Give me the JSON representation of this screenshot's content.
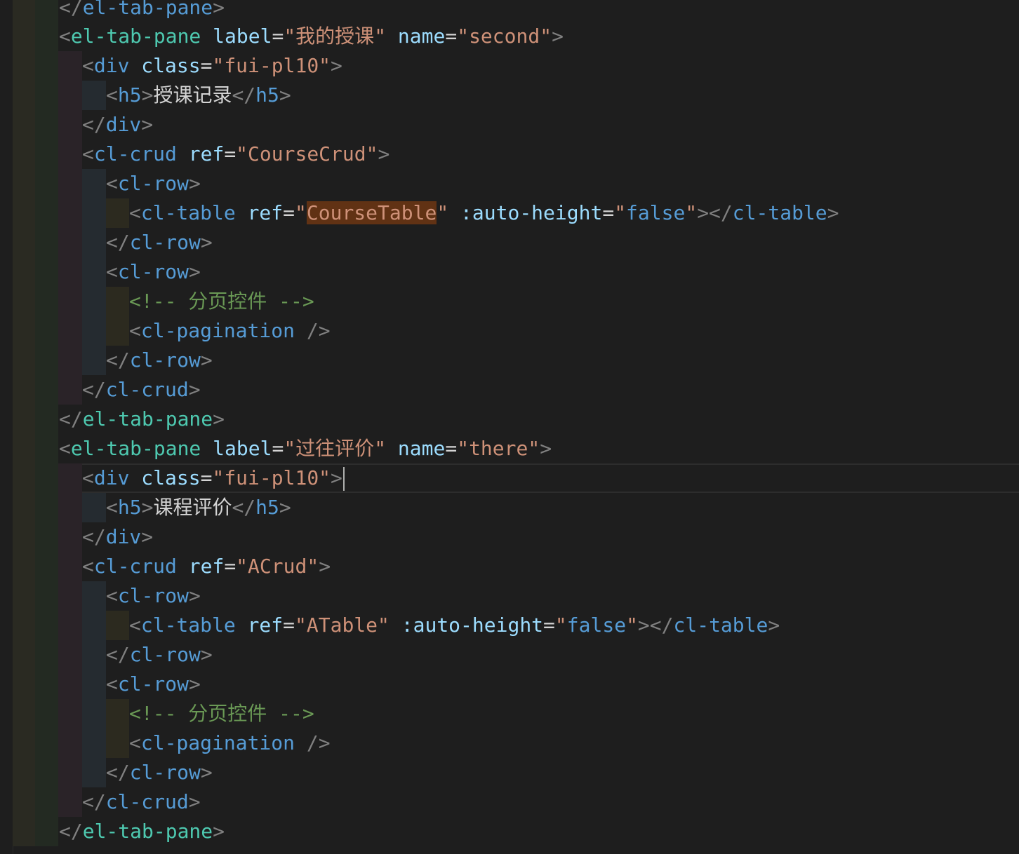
{
  "editor": {
    "theme_background": "#1e1e1e",
    "colors": {
      "bracket": "#808080",
      "tag": "#569cd6",
      "component_tag": "#4ec9b0",
      "attribute": "#9cdcfe",
      "string": "#ce9178",
      "comment": "#6a9955",
      "text": "#d4d4d4",
      "find_highlight": "#613214"
    },
    "lines": {
      "l0": {
        "close_tag": "el-tab-pane"
      },
      "l1": {
        "tag": "el-tab-pane",
        "attr1": "label",
        "val1": "我的授课",
        "attr2": "name",
        "val2": "second"
      },
      "l2": {
        "tag": "div",
        "attr1": "class",
        "val1": "fui-pl10"
      },
      "l3": {
        "tag": "h5",
        "text": "授课记录"
      },
      "l4": {
        "close_tag": "div"
      },
      "l5": {
        "tag": "cl-crud",
        "attr1": "ref",
        "val1": "CourseCrud"
      },
      "l6": {
        "tag": "cl-row"
      },
      "l7": {
        "tag": "cl-table",
        "attr1": "ref",
        "val1": "CourseTable",
        "attr2": ":auto-height",
        "val2": "false"
      },
      "l8": {
        "close_tag": "cl-row"
      },
      "l9": {
        "tag": "cl-row"
      },
      "l10": {
        "comment": "<!-- 分页控件 -->"
      },
      "l11": {
        "tag": "cl-pagination"
      },
      "l12": {
        "close_tag": "cl-row"
      },
      "l13": {
        "close_tag": "cl-crud"
      },
      "l14": {
        "close_tag": "el-tab-pane"
      },
      "l15": {
        "tag": "el-tab-pane",
        "attr1": "label",
        "val1": "过往评价",
        "attr2": "name",
        "val2": "there"
      },
      "l16": {
        "tag": "div",
        "attr1": "class",
        "val1": "fui-pl10"
      },
      "l17": {
        "tag": "h5",
        "text": "课程评价"
      },
      "l18": {
        "close_tag": "div"
      },
      "l19": {
        "tag": "cl-crud",
        "attr1": "ref",
        "val1": "ACrud"
      },
      "l20": {
        "tag": "cl-row"
      },
      "l21": {
        "tag": "cl-table",
        "attr1": "ref",
        "val1": "ATable",
        "attr2": ":auto-height",
        "val2": "false"
      },
      "l22": {
        "close_tag": "cl-row"
      },
      "l23": {
        "tag": "cl-row"
      },
      "l24": {
        "comment": "<!-- 分页控件 -->"
      },
      "l25": {
        "tag": "cl-pagination"
      },
      "l26": {
        "close_tag": "cl-row"
      },
      "l27": {
        "close_tag": "cl-crud"
      },
      "l28": {
        "close_tag": "el-tab-pane"
      }
    }
  }
}
